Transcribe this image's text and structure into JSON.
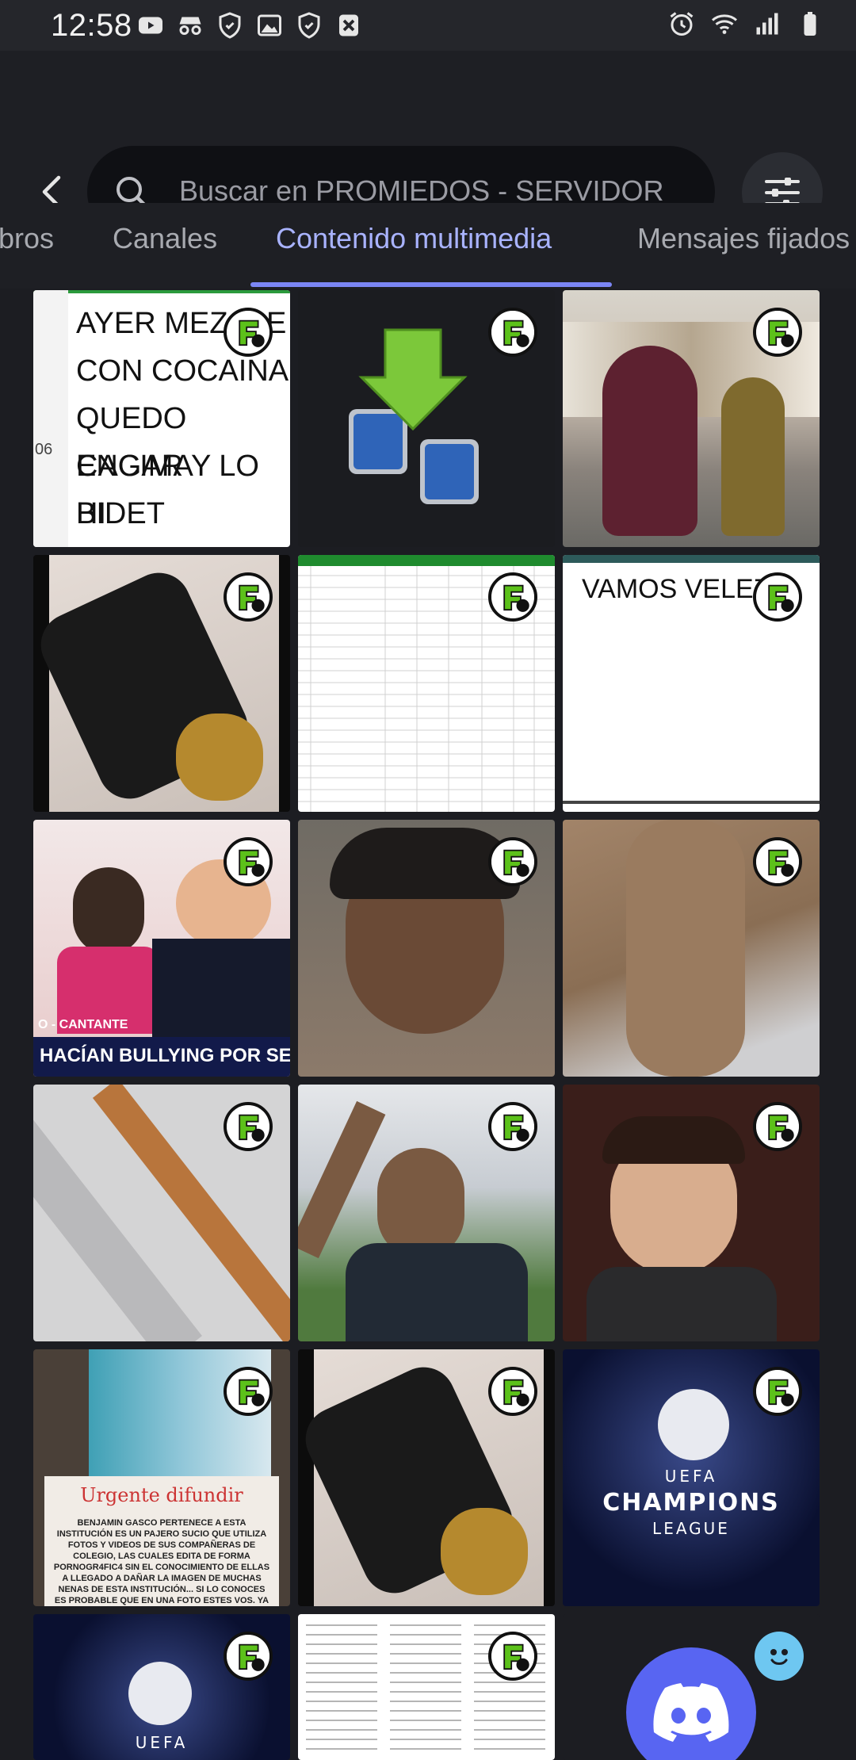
{
  "status_bar": {
    "time": "12:58",
    "left_icons": [
      "youtube-icon",
      "incognito-icon",
      "hand-shield-icon",
      "image-icon",
      "hand-shield-icon",
      "close-box-icon"
    ],
    "right_icons": [
      "alarm-icon",
      "wifi-icon",
      "signal-icon",
      "battery-icon"
    ]
  },
  "header": {
    "back_icon": "chevron-left-icon",
    "search_placeholder": "Buscar en PROMIEDOS - SERVIDOR",
    "filter_icon": "sliders-icon"
  },
  "tabs": [
    {
      "label": "bros",
      "active": false
    },
    {
      "label": "Canales",
      "active": false
    },
    {
      "label": "Contenido multimedia",
      "active": true
    },
    {
      "label": "Mensajes fijados",
      "active": false
    }
  ],
  "media": {
    "tile1_lines": [
      "AYER MEZCLE",
      "CON COCAINA",
      "QUEDO ENCIMA",
      "CAGAR Y LO HI",
      "BIDET"
    ],
    "tile1_side": "06",
    "tile6_text": "VAMOS VELEZ!!!",
    "tile7_caption": "HACÍAN BULLYING POR SER DE RACI",
    "tile7_tag": "O - CANTANTE",
    "tile13_title": "Urgente difundir",
    "tile13_body": "BENJAMIN GASCO PERTENECE A ESTA INSTITUCIÓN ES UN PAJERO SUCIO QUE UTILIZA FOTOS Y VIDEOS DE SUS COMPAÑERAS DE COLEGIO, LAS CUALES EDITA DE FORMA PORNOGR4FIC4 SIN EL CONOCIMIENTO DE ELLAS A LLEGADO A DAÑAR LA IMAGEN DE MUCHAS NENAS DE ESTA INSTITUCIÓN... SI LO CONOCES ES PROBABLE QUE EN UNA FOTO ESTES VOS. YA QUE SON MUCHAS LAS IMAGENES QUE LLEGÓ A EDITAR ESTE",
    "ucl_line1": "UEFA",
    "ucl_line2": "CHAMPIONS",
    "ucl_line3": "LEAGUE",
    "ucl_partial": "UEFA"
  },
  "colors": {
    "accent": "#a9b3ff",
    "indicator": "#7b86f5",
    "background": "#1c1d22",
    "discord": "#5865f2"
  }
}
